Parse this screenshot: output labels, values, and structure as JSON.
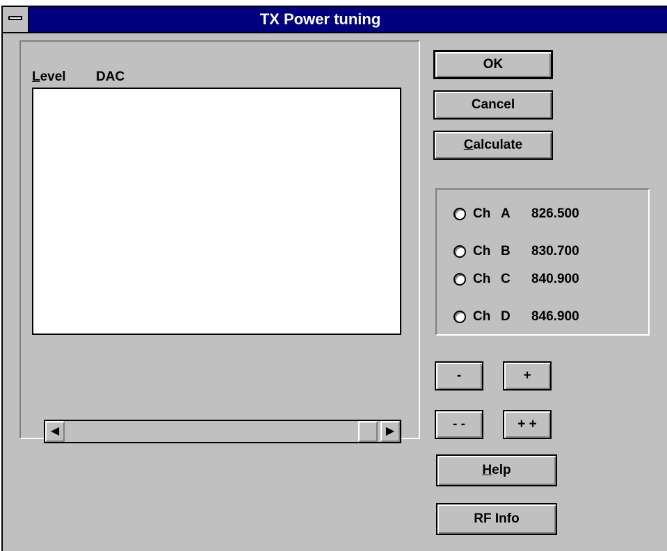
{
  "window": {
    "title": "TX Power tuning"
  },
  "list": {
    "level_label": "Level",
    "dac_label": "DAC",
    "items": []
  },
  "buttons": {
    "ok": "OK",
    "cancel": "Cancel",
    "calculate": "Calculate",
    "minus": "-",
    "plus": "+",
    "minus_minus": "- -",
    "plus_plus": "+ +",
    "help": "Help",
    "rf_info": "RF Info"
  },
  "channels": [
    {
      "prefix": "Ch",
      "letter": "A",
      "freq": "826.500",
      "selected": false
    },
    {
      "prefix": "Ch",
      "letter": "B",
      "freq": "830.700",
      "selected": false
    },
    {
      "prefix": "Ch",
      "letter": "C",
      "freq": "840.900",
      "selected": false
    },
    {
      "prefix": "Ch",
      "letter": "D",
      "freq": "846.900",
      "selected": false
    }
  ],
  "scrollbar": {
    "left_icon": "arrow-left-icon",
    "right_icon": "arrow-right-icon"
  },
  "colors": {
    "titlebar": "#00007f",
    "face": "#c0c0c0"
  }
}
